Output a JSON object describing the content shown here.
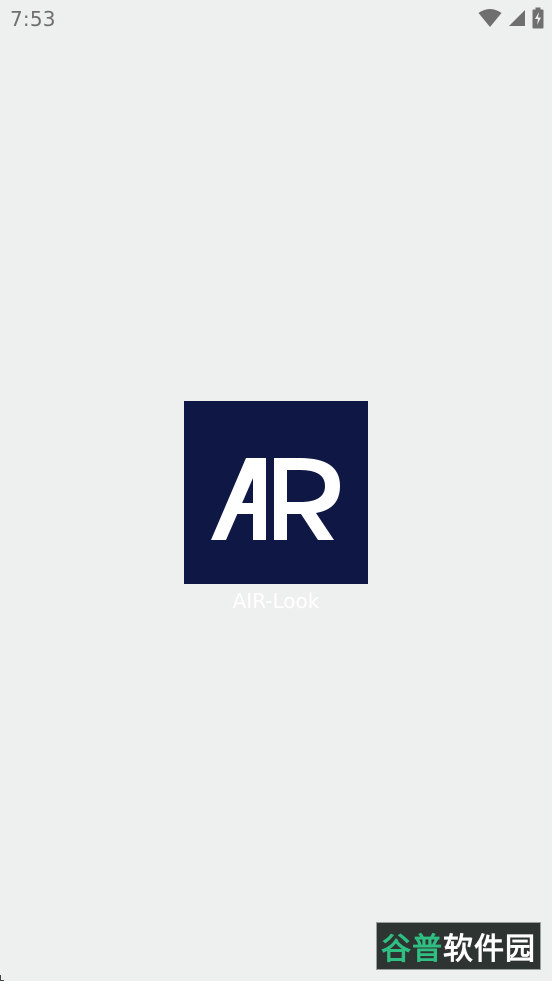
{
  "status_bar": {
    "time": "7:53",
    "icons": [
      "wifi-icon",
      "cellular-signal-icon",
      "battery-charging-icon"
    ],
    "icon_color": "#6f6f6f"
  },
  "splash": {
    "logo_text": "AR",
    "logo_bg_color": "#0f1745",
    "logo_fg_color": "#ffffff",
    "app_name": "AIR-Look"
  },
  "watermark": {
    "text": "谷普软件园",
    "part_green": "谷普",
    "part_white": "软件园",
    "green_color": "#2fbf83"
  },
  "background_color": "#eef0ef"
}
